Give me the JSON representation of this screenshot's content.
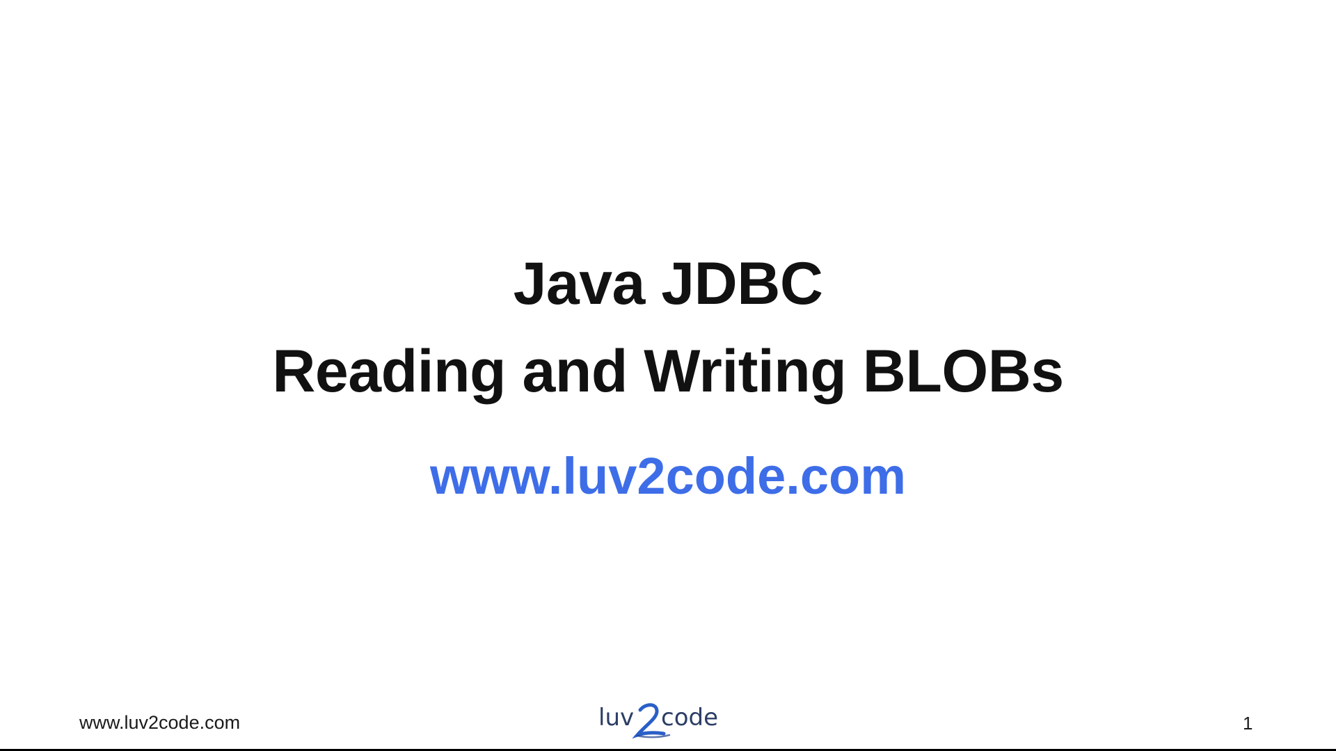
{
  "slide": {
    "title_line_1": "Java JDBC",
    "title_line_2": "Reading and Writing BLOBs",
    "subtitle": "www.luv2code.com"
  },
  "footer": {
    "url": "www.luv2code.com",
    "logo_text": "luv2code",
    "page_number": "1"
  },
  "colors": {
    "title": "#111111",
    "subtitle": "#3e6de8",
    "logo_text": "#2c3e66",
    "logo_swoosh": "#2a5fc7",
    "background": "#ffffff"
  }
}
